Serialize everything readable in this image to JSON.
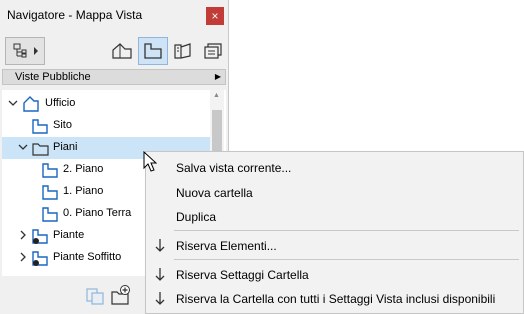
{
  "window": {
    "title": "Navigatore - Mappa Vista",
    "close_label": "×"
  },
  "toolbar": {
    "icons": [
      "project-map-icon",
      "view-map-icon",
      "layout-book-icon",
      "publisher-sets-icon"
    ],
    "active": "view-map-icon"
  },
  "view_selector": {
    "label": "Viste Pubbliche",
    "arrow": "▶"
  },
  "tree": {
    "items": [
      {
        "label": "Ufficio",
        "icon": "project-root-icon",
        "expander": "expanded"
      },
      {
        "label": "Sito",
        "icon": "view-icon",
        "expander": "none"
      },
      {
        "label": "Piani",
        "icon": "folder-icon",
        "expander": "expanded",
        "selected": true
      },
      {
        "label": "2. Piano",
        "icon": "view-icon",
        "expander": "none"
      },
      {
        "label": "1. Piano",
        "icon": "view-icon",
        "expander": "none"
      },
      {
        "label": "0. Piano Terra",
        "icon": "view-icon",
        "expander": "none"
      },
      {
        "label": "Piante",
        "icon": "folder-reserved-icon",
        "expander": "collapsed"
      },
      {
        "label": "Piante Soffitto",
        "icon": "folder-reserved-icon",
        "expander": "collapsed"
      }
    ]
  },
  "bottom_bar": {
    "icons": [
      "clone-folder-icon",
      "new-folder-icon"
    ]
  },
  "context_menu": {
    "items": [
      {
        "label": "Salva vista corrente...",
        "icon": ""
      },
      {
        "label": "Nuova cartella",
        "icon": ""
      },
      {
        "label": "Duplica",
        "icon": ""
      },
      {
        "label": "Riserva Elementi...",
        "icon": "reserve-down-arrow-icon"
      },
      {
        "label": "Riserva Settaggi Cartella",
        "icon": "reserve-down-arrow-icon"
      },
      {
        "label": "Riserva la Cartella con tutti i Settaggi Vista inclusi disponibili",
        "icon": "reserve-down-arrow-icon"
      }
    ]
  },
  "colors": {
    "selection": "#cce4f7",
    "close_button": "#c23b37",
    "icon_blue": "#1a66c2"
  }
}
